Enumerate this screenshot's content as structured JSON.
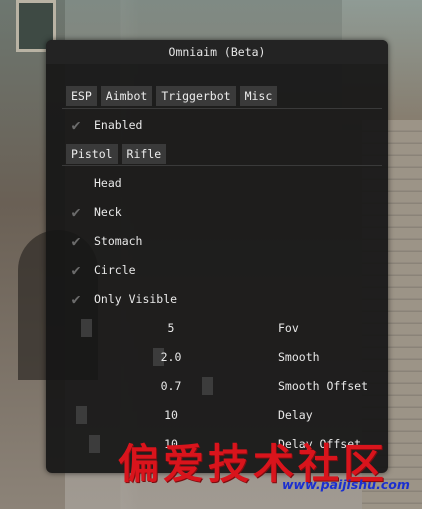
{
  "window": {
    "title": "Omniaim (Beta)"
  },
  "tabs": [
    "ESP",
    "Aimbot",
    "Triggerbot",
    "Misc"
  ],
  "enabled": {
    "label": "Enabled",
    "checked": true
  },
  "weapon_tabs": [
    "Pistol",
    "Rifle"
  ],
  "hitboxes": [
    {
      "label": "Head",
      "checked": false
    },
    {
      "label": "Neck",
      "checked": true
    },
    {
      "label": "Stomach",
      "checked": true
    },
    {
      "label": "Circle",
      "checked": true
    },
    {
      "label": "Only Visible",
      "checked": true
    }
  ],
  "sliders": [
    {
      "label": "Fov",
      "value": "5",
      "fraction": 0.04
    },
    {
      "label": "Smooth",
      "value": "2.0",
      "fraction": 0.6
    },
    {
      "label": "Smooth Offset",
      "value": "0.7",
      "fraction": 0.98
    },
    {
      "label": "Delay",
      "value": "10",
      "fraction": 0.0
    },
    {
      "label": "Delay Offset",
      "value": "10",
      "fraction": 0.1
    }
  ],
  "watermark": {
    "text": "偏爱技术社区",
    "url": "www.paijishu.com"
  }
}
